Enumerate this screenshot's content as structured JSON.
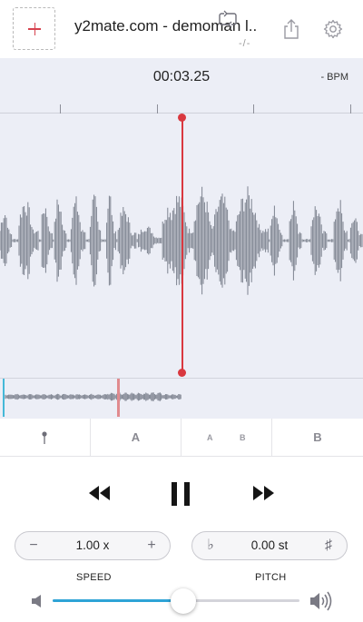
{
  "header": {
    "add_icon": "plus-icon",
    "title": "y2mate.com - demoman l...",
    "subtitle": "-/-",
    "share_icon": "share-icon",
    "settings_icon": "gear-icon"
  },
  "wave": {
    "time": "00:03.25",
    "bpm": "- BPM",
    "playhead_color": "#d9383f",
    "wave_color": "#7e8390"
  },
  "loop": {
    "marker_icon": "pin-icon",
    "a_label": "A",
    "ab_a": "A",
    "ab_b": "B",
    "ab_icon": "loop-icon",
    "b_label": "B"
  },
  "transport": {
    "rewind_icon": "rewind-icon",
    "pause_icon": "pause-icon",
    "forward_icon": "fast-forward-icon"
  },
  "speed": {
    "minus": "−",
    "value": "1.00 x",
    "plus": "+",
    "label": "SPEED"
  },
  "pitch": {
    "flat": "♭",
    "value": "0.00 st",
    "sharp": "♯",
    "label": "PITCH"
  },
  "volume": {
    "level": 0.53,
    "accent": "#2ea3d6",
    "low_icon": "volume-low-icon",
    "high_icon": "volume-high-icon"
  }
}
